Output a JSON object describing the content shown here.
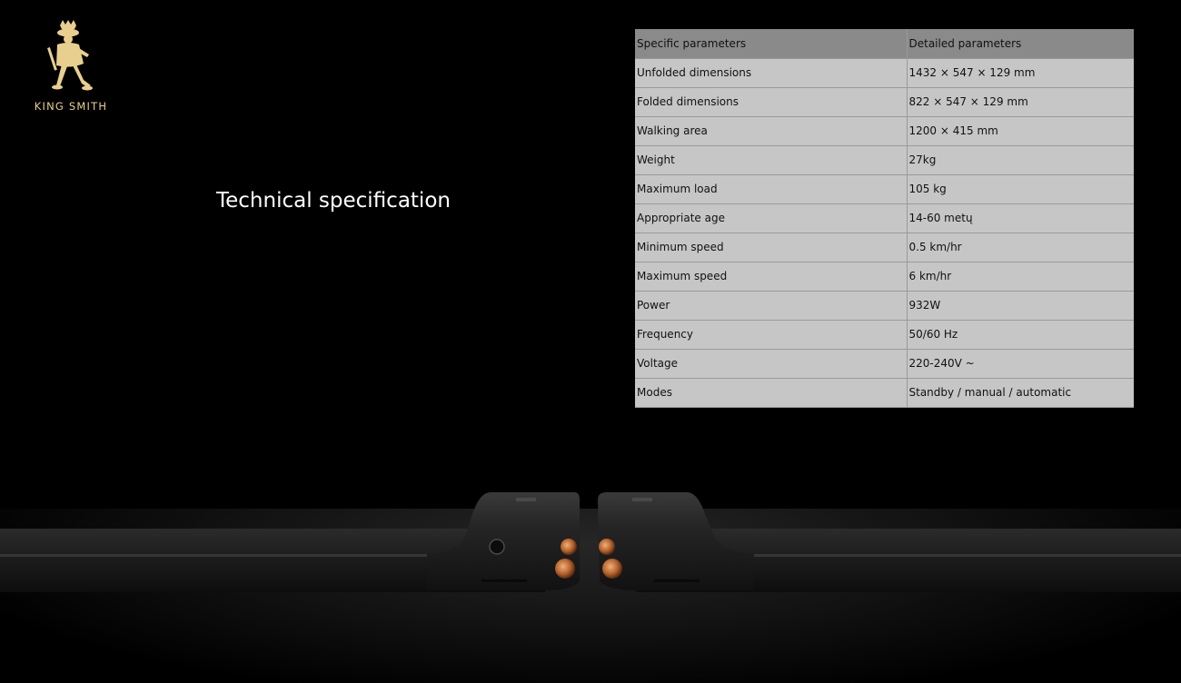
{
  "brand": {
    "name": "KING SMITH",
    "accent_color": "#e9cf8f"
  },
  "heading": "Technical specification",
  "table": {
    "header": {
      "col_a": "Specific parameters",
      "col_b": "Detailed parameters"
    },
    "rows": [
      {
        "param": "Unfolded dimensions",
        "value": "1432 × 547 × 129 mm"
      },
      {
        "param": "Folded dimensions",
        "value": "822 × 547 × 129 mm"
      },
      {
        "param": "Walking area",
        "value": "1200 × 415 mm"
      },
      {
        "param": "Weight",
        "value": "27kg"
      },
      {
        "param": "Maximum load",
        "value": "105 kg"
      },
      {
        "param": "Appropriate age",
        "value": "14-60 metų"
      },
      {
        "param": "Minimum speed",
        "value": "0.5 km/hr"
      },
      {
        "param": "Maximum speed",
        "value": "6 km/hr"
      },
      {
        "param": "Power",
        "value": "932W"
      },
      {
        "param": "Frequency",
        "value": "50/60 Hz"
      },
      {
        "param": "Voltage",
        "value": "220-240V ~"
      },
      {
        "param": "Modes",
        "value": "Standby / manual / automatic"
      }
    ]
  },
  "product_image": {
    "icon": "folded-walking-pad-image"
  }
}
